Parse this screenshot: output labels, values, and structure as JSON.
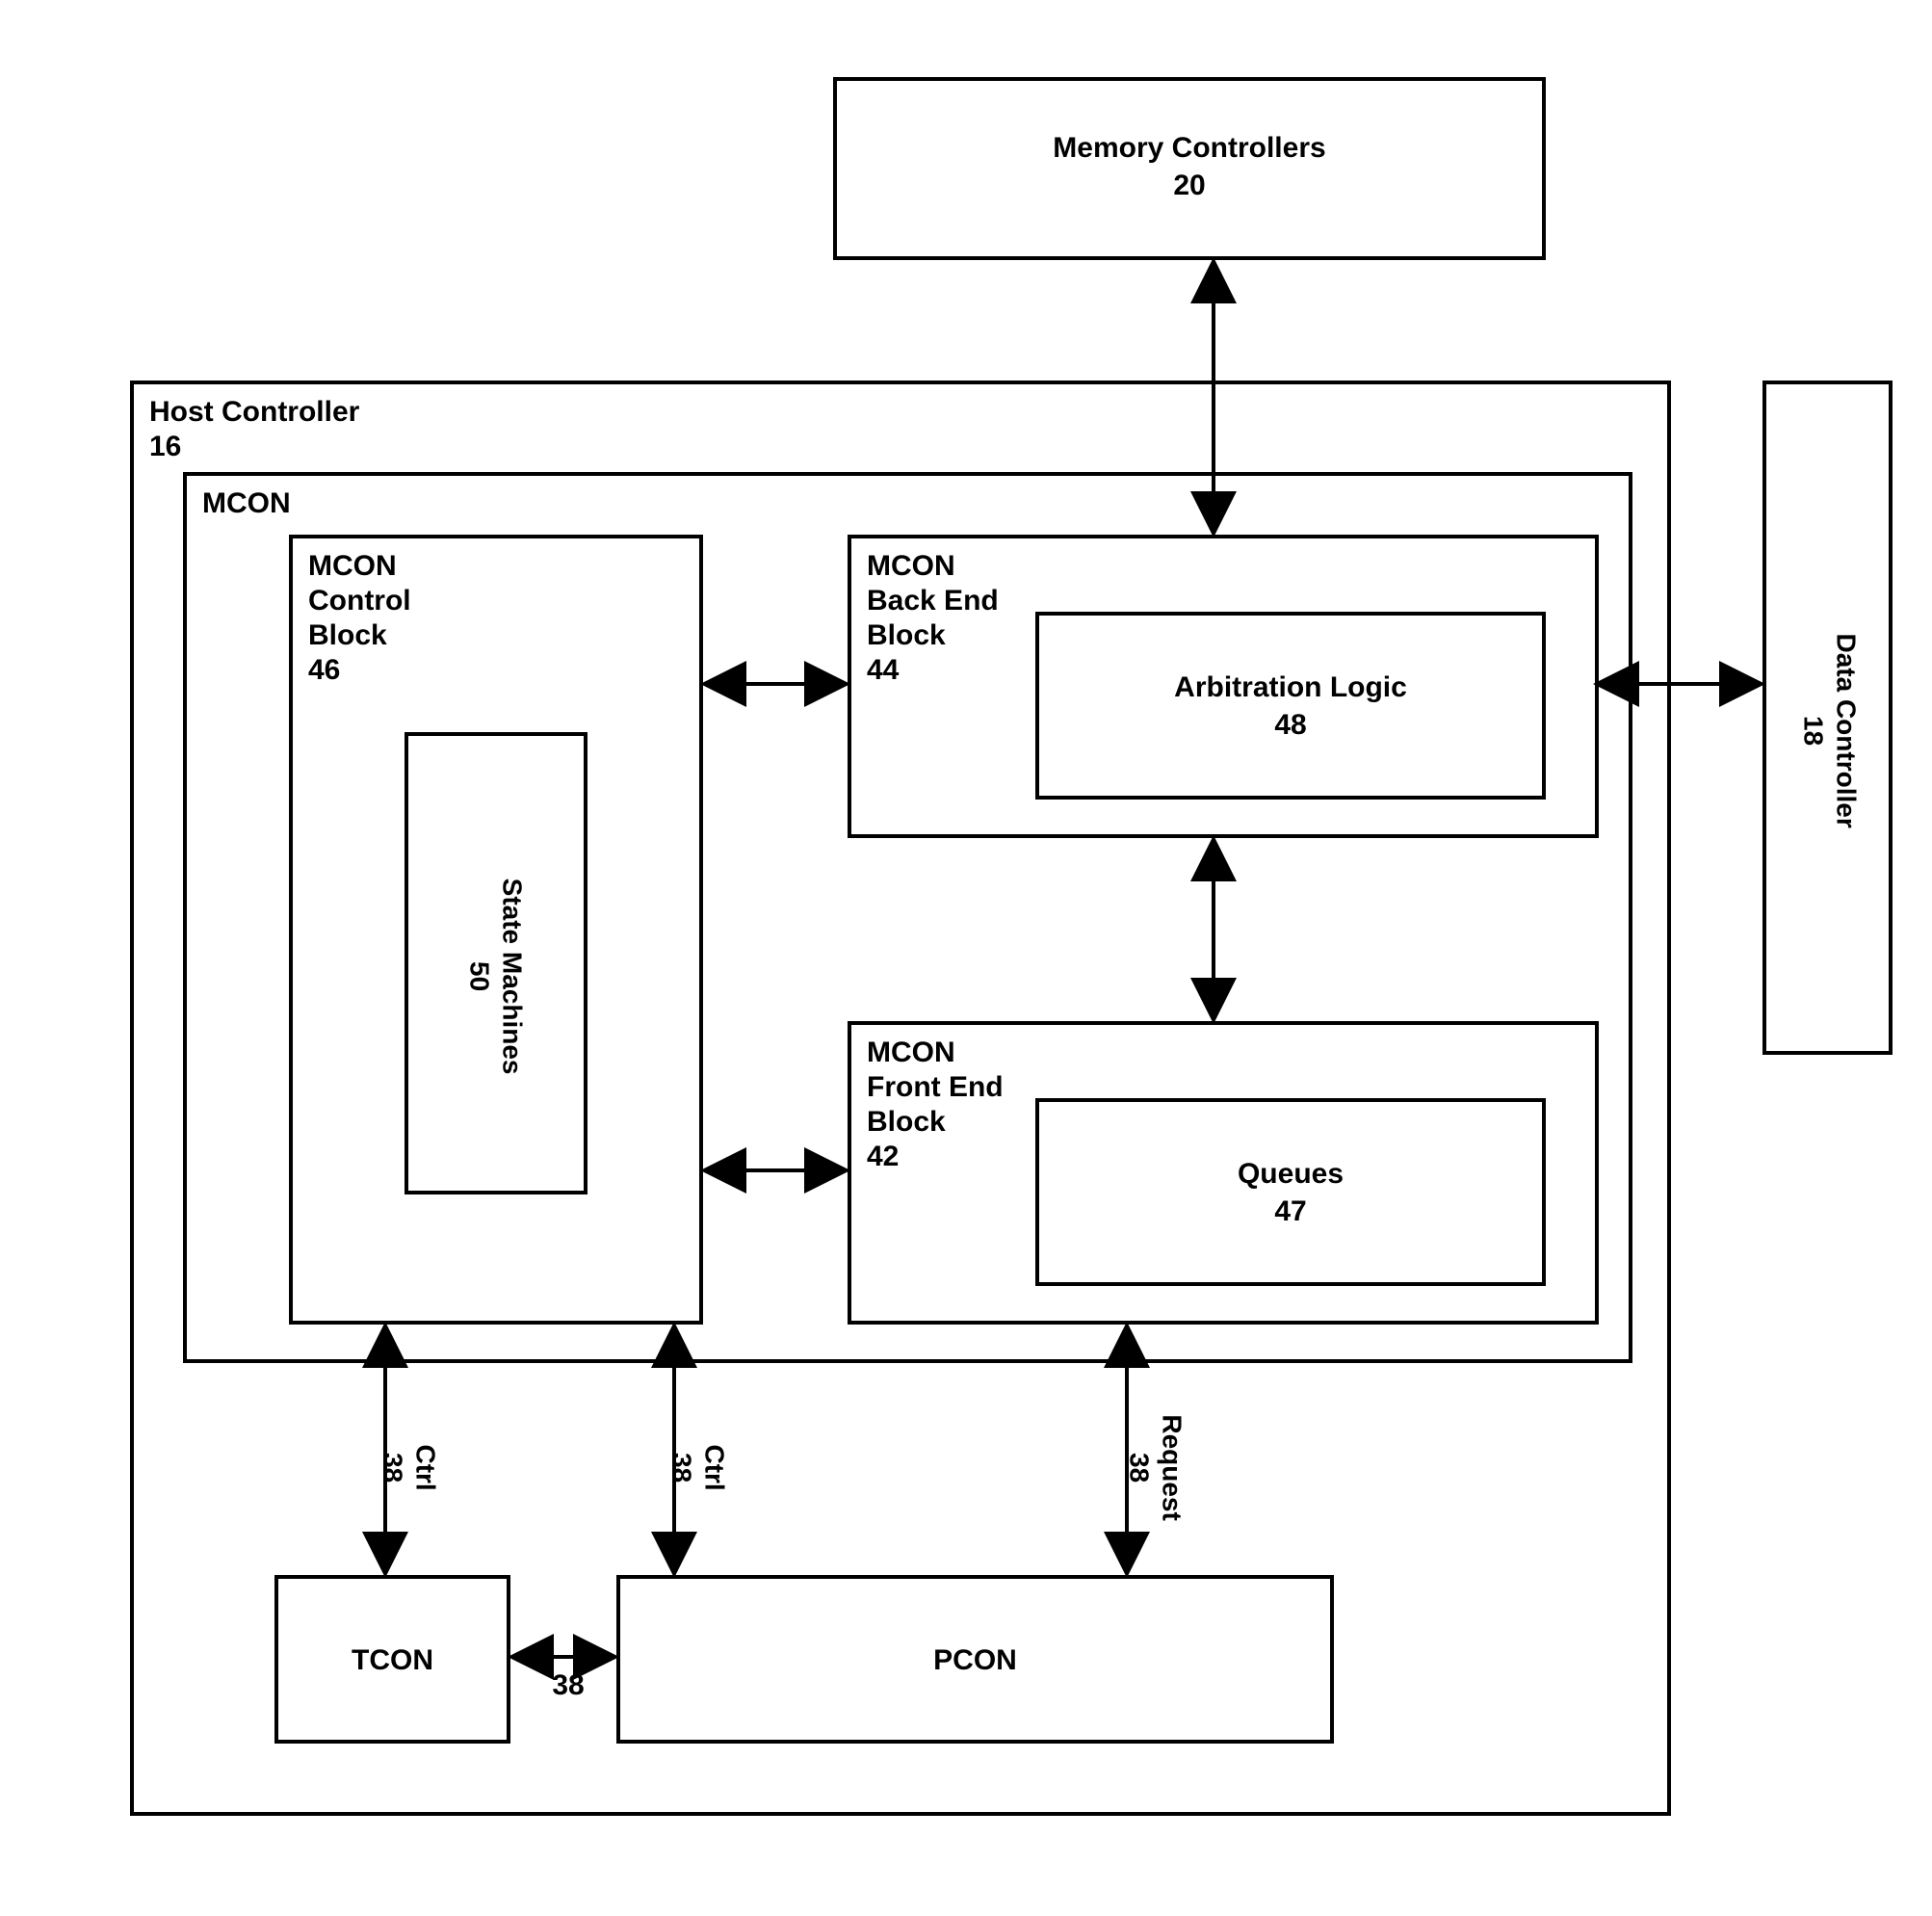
{
  "memoryControllers": {
    "title": "Memory Controllers",
    "num": "20"
  },
  "hostController": {
    "title": "Host Controller",
    "num": "16"
  },
  "mcon": {
    "title": "MCON"
  },
  "mconControl": {
    "title": "MCON",
    "l2": "Control",
    "l3": "Block",
    "num": "46"
  },
  "stateMachines": {
    "title": "State Machines",
    "num": "50"
  },
  "mconBackEnd": {
    "title": "MCON",
    "l2": "Back End",
    "l3": "Block",
    "num": "44"
  },
  "arbitration": {
    "title": "Arbitration Logic",
    "num": "48"
  },
  "mconFrontEnd": {
    "title": "MCON",
    "l2": "Front End",
    "l3": "Block",
    "num": "42"
  },
  "queues": {
    "title": "Queues",
    "num": "47"
  },
  "dataController": {
    "title": "Data Controller",
    "num": "18"
  },
  "tcon": {
    "title": "TCON"
  },
  "pcon": {
    "title": "PCON"
  },
  "conn": {
    "ctrl": "Ctrl",
    "request": "Request",
    "n38": "38"
  }
}
